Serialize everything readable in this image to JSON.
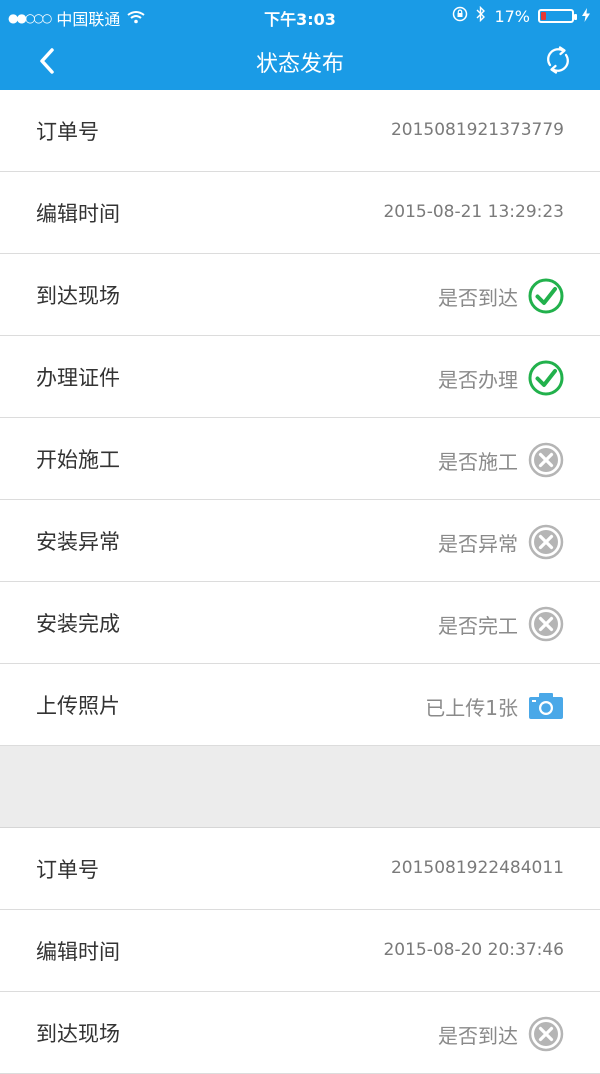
{
  "status_bar": {
    "carrier": "中国联通",
    "signal_dots": "●●○○○",
    "time": "下午3:03",
    "battery": "17%",
    "battery_level": 0.17
  },
  "header": {
    "title": "状态发布",
    "back_icon": "chevron-left-icon",
    "refresh_icon": "refresh-icon"
  },
  "colors": {
    "header_bg": "#1a9be6",
    "check_green": "#22b14c",
    "cross_gray": "#b5b5b5",
    "camera_blue": "#4aa8e8"
  },
  "orders": [
    {
      "order_label": "订单号",
      "order_number": "2015081921373779",
      "edit_time_label": "编辑时间",
      "edit_time": "2015-08-21 13:29:23",
      "items": [
        {
          "label": "到达现场",
          "question": "是否到达",
          "status": "checked"
        },
        {
          "label": "办理证件",
          "question": "是否办理",
          "status": "checked"
        },
        {
          "label": "开始施工",
          "question": "是否施工",
          "status": "unchecked"
        },
        {
          "label": "安装异常",
          "question": "是否异常",
          "status": "unchecked"
        },
        {
          "label": "安装完成",
          "question": "是否完工",
          "status": "unchecked"
        }
      ],
      "photo_label": "上传照片",
      "photo_status": "已上传1张"
    },
    {
      "order_label": "订单号",
      "order_number": "2015081922484011",
      "edit_time_label": "编辑时间",
      "edit_time": "2015-08-20 20:37:46",
      "items": [
        {
          "label": "到达现场",
          "question": "是否到达",
          "status": "unchecked"
        }
      ]
    }
  ]
}
